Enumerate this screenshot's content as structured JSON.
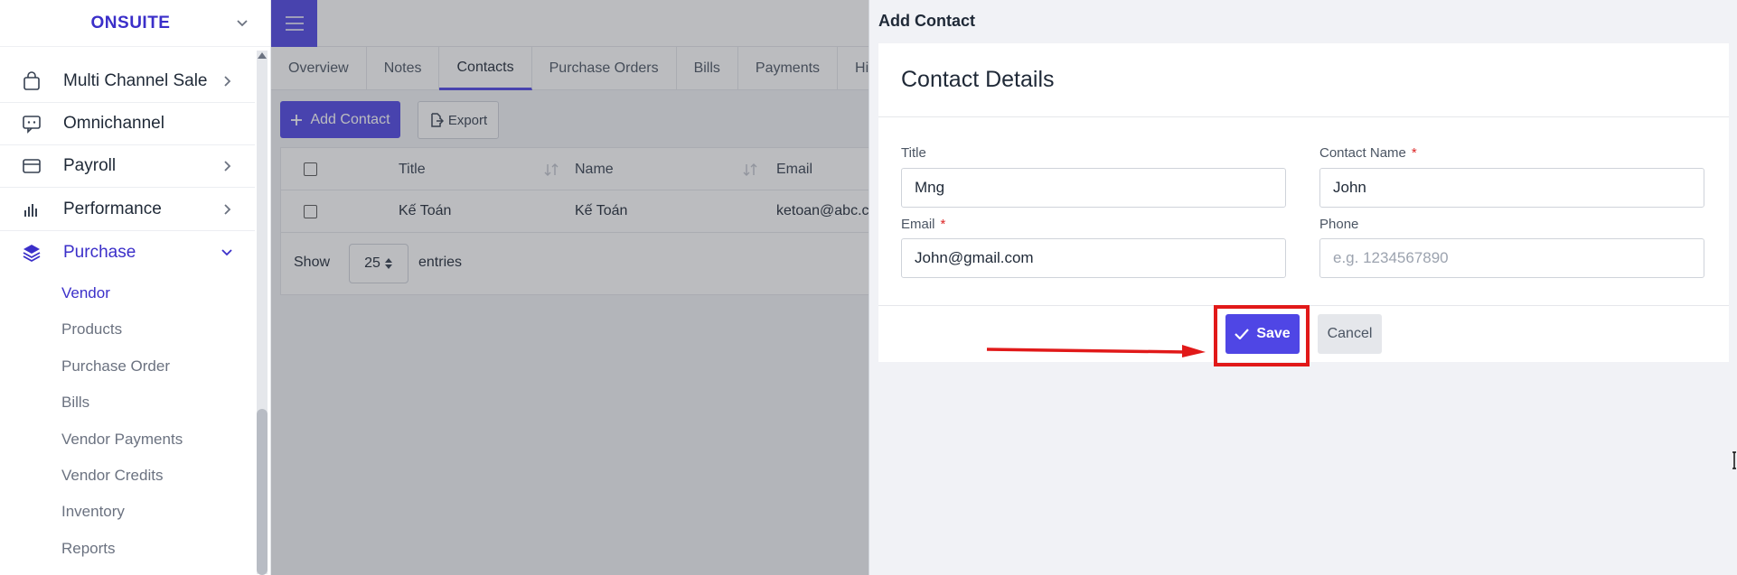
{
  "brand": {
    "name": "ONSUITE"
  },
  "sidebar": {
    "items": [
      {
        "label": "Multi Channel Sale",
        "icon": "bag-icon",
        "has_arrow": true
      },
      {
        "label": "Omnichannel",
        "icon": "chat-icon",
        "has_arrow": false
      },
      {
        "label": "Payroll",
        "icon": "card-icon",
        "has_arrow": true
      },
      {
        "label": "Performance",
        "icon": "bar-chart-icon",
        "has_arrow": true
      },
      {
        "label": "Purchase",
        "icon": "layers-icon",
        "has_arrow": true,
        "expanded": true
      }
    ],
    "sub_items": [
      "Vendor",
      "Products",
      "Purchase Order",
      "Bills",
      "Vendor Payments",
      "Vendor Credits",
      "Inventory",
      "Reports"
    ],
    "active_sub": "Vendor"
  },
  "tabs": [
    "Overview",
    "Notes",
    "Contacts",
    "Purchase Orders",
    "Bills",
    "Payments",
    "Hi"
  ],
  "active_tab": "Contacts",
  "toolbar": {
    "add_label": "Add Contact",
    "export_label": "Export"
  },
  "table": {
    "headers": [
      "Title",
      "Name",
      "Email"
    ],
    "rows": [
      {
        "title": "Kế Toán",
        "name": "Kế Toán",
        "email": "ketoan@abc.c"
      }
    ]
  },
  "pagination": {
    "show_label": "Show",
    "page_size": "25",
    "entries_label": "entries"
  },
  "drawer": {
    "title": "Add Contact",
    "card_title": "Contact Details",
    "fields": {
      "title": {
        "label": "Title",
        "value": "Mng",
        "required": false
      },
      "contact_name": {
        "label": "Contact Name",
        "value": "John",
        "required": true
      },
      "email": {
        "label": "Email",
        "value": "John@gmail.com",
        "required": true
      },
      "phone": {
        "label": "Phone",
        "placeholder": "e.g. 1234567890",
        "required": false
      }
    },
    "save_label": "Save",
    "cancel_label": "Cancel",
    "required_mark": "*"
  },
  "colors": {
    "accent": "#4f46e5",
    "brand": "#3b2fc9",
    "annotation": "#e11919"
  }
}
